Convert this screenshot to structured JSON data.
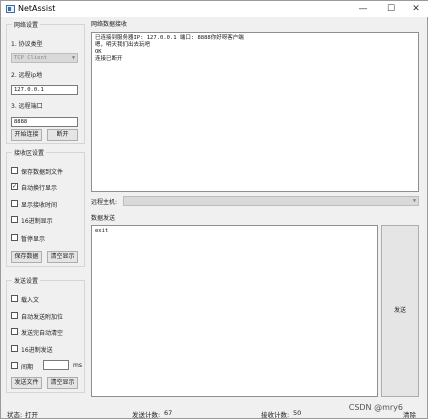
{
  "window": {
    "title": "NetAssist",
    "minimize": "—",
    "maximize": "☐",
    "close": "✕"
  },
  "network_settings": {
    "title": "网络设置",
    "protocol_label": "1. 协议类型",
    "protocol_value": "TCP Client",
    "remote_ip_label": "2. 远程ip地",
    "remote_ip_value": "127.0.0.1",
    "remote_port_label": "3. 远程端口",
    "remote_port_value": "8888",
    "connect_button": "开始连接",
    "disconnect_button": "断开"
  },
  "receive_settings": {
    "title": "接收区设置",
    "options": [
      {
        "label": "保存数据到文件",
        "checked": false
      },
      {
        "label": "自动换行显示",
        "checked": true
      },
      {
        "label": "显示接收时间",
        "checked": false
      },
      {
        "label": "16进制显示",
        "checked": false
      },
      {
        "label": "暂停显示",
        "checked": false
      }
    ],
    "save_button": "保存数据",
    "clear_button": "清空显示"
  },
  "send_settings": {
    "title": "发送设置",
    "options": [
      {
        "label": "载入文",
        "checked": false
      },
      {
        "label": "自动发送附加位",
        "checked": false
      },
      {
        "label": "发送完自动清空",
        "checked": false
      },
      {
        "label": "16进制发送",
        "checked": false
      },
      {
        "label": "间期",
        "checked": false
      }
    ],
    "interval_unit": "ms",
    "send_file_button": "发送文件",
    "clear_button": "清空显示"
  },
  "receive_area": {
    "title": "网络数据接收",
    "lines": [
      "已连接到服务器IP: 127.0.0.1 端口: 8888你好呀客户端",
      "嗯，明天我们出去玩吧",
      "OK",
      "连接已断开"
    ]
  },
  "remote_host": {
    "label": "远程主机:"
  },
  "send_area": {
    "title": "数据发送",
    "text": "exit",
    "send_button": "发送"
  },
  "status": {
    "state_label": "状态:",
    "state_value": "打开",
    "sent_label": "发送计数:",
    "sent_value": "67",
    "recv_label": "接收计数:",
    "recv_value": "50",
    "clear_button": "清除"
  },
  "watermark": "CSDN @mry6"
}
